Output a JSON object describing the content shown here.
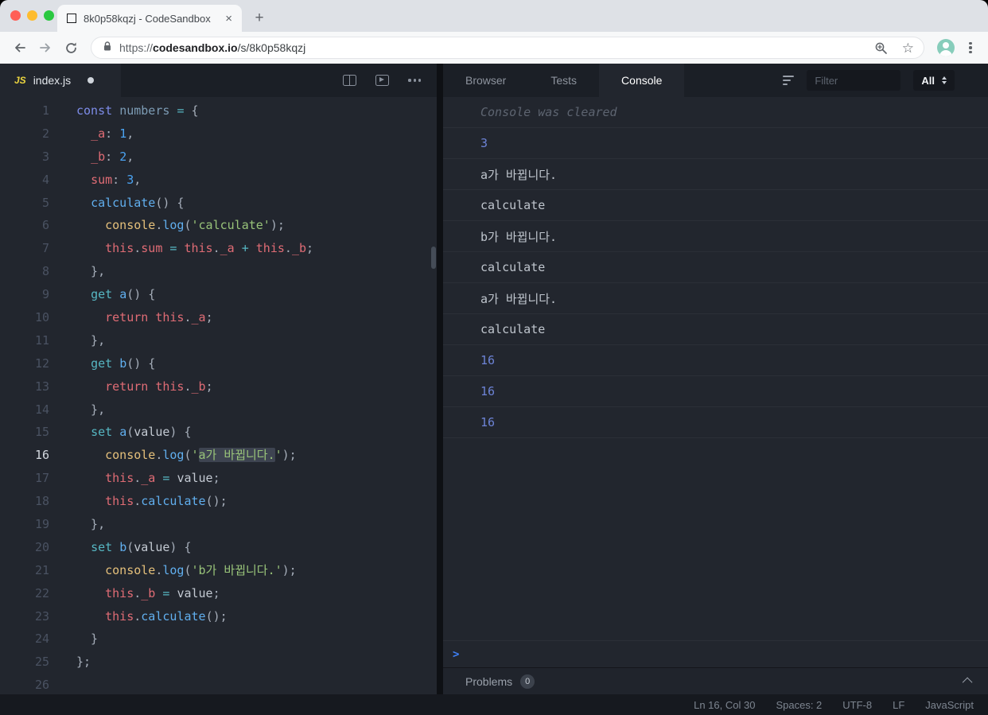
{
  "browser": {
    "tab_title": "8k0p58kqzj - CodeSandbox",
    "close_glyph": "×",
    "new_tab_glyph": "+",
    "star_glyph": "☆",
    "url_scheme": "https://",
    "url_host": "codesandbox.io",
    "url_path": "/s/8k0p58kqzj"
  },
  "editor": {
    "file_tab": {
      "icon_label": "JS",
      "name": "index.js"
    },
    "active_line": 16,
    "code_lines": [
      {
        "n": "1",
        "tk": [
          [
            "kw",
            "const"
          ],
          [
            "def",
            " "
          ],
          [
            "var",
            "numbers"
          ],
          [
            "def",
            " "
          ],
          [
            "op",
            "="
          ],
          [
            "def",
            " {"
          ]
        ]
      },
      {
        "n": "2",
        "tk": [
          [
            "def",
            "  "
          ],
          [
            "prop",
            "_a"
          ],
          [
            "def",
            ": "
          ],
          [
            "num",
            "1"
          ],
          [
            "def",
            ","
          ]
        ]
      },
      {
        "n": "3",
        "tk": [
          [
            "def",
            "  "
          ],
          [
            "prop",
            "_b"
          ],
          [
            "def",
            ": "
          ],
          [
            "num",
            "2"
          ],
          [
            "def",
            ","
          ]
        ]
      },
      {
        "n": "4",
        "tk": [
          [
            "def",
            "  "
          ],
          [
            "prop",
            "sum"
          ],
          [
            "def",
            ": "
          ],
          [
            "num",
            "3"
          ],
          [
            "def",
            ","
          ]
        ]
      },
      {
        "n": "5",
        "tk": [
          [
            "def",
            "  "
          ],
          [
            "fn",
            "calculate"
          ],
          [
            "def",
            "() {"
          ]
        ]
      },
      {
        "n": "6",
        "tk": [
          [
            "def",
            "    "
          ],
          [
            "obj",
            "console"
          ],
          [
            "def",
            "."
          ],
          [
            "fn",
            "log"
          ],
          [
            "def",
            "("
          ],
          [
            "str",
            "'calculate'"
          ],
          [
            "def",
            ");"
          ]
        ]
      },
      {
        "n": "7",
        "tk": [
          [
            "def",
            "    "
          ],
          [
            "this",
            "this"
          ],
          [
            "def",
            "."
          ],
          [
            "prop",
            "sum"
          ],
          [
            "def",
            " "
          ],
          [
            "op",
            "="
          ],
          [
            "def",
            " "
          ],
          [
            "this",
            "this"
          ],
          [
            "def",
            "."
          ],
          [
            "prop",
            "_a"
          ],
          [
            "def",
            " "
          ],
          [
            "op",
            "+"
          ],
          [
            "def",
            " "
          ],
          [
            "this",
            "this"
          ],
          [
            "def",
            "."
          ],
          [
            "prop",
            "_b"
          ],
          [
            "def",
            ";"
          ]
        ]
      },
      {
        "n": "8",
        "tk": [
          [
            "def",
            "  },"
          ]
        ]
      },
      {
        "n": "9",
        "tk": [
          [
            "def",
            "  "
          ],
          [
            "kw2",
            "get"
          ],
          [
            "def",
            " "
          ],
          [
            "fn",
            "a"
          ],
          [
            "def",
            "() {"
          ]
        ]
      },
      {
        "n": "10",
        "tk": [
          [
            "def",
            "    "
          ],
          [
            "ret",
            "return"
          ],
          [
            "def",
            " "
          ],
          [
            "this",
            "this"
          ],
          [
            "def",
            "."
          ],
          [
            "prop",
            "_a"
          ],
          [
            "def",
            ";"
          ]
        ]
      },
      {
        "n": "11",
        "tk": [
          [
            "def",
            "  },"
          ]
        ]
      },
      {
        "n": "12",
        "tk": [
          [
            "def",
            "  "
          ],
          [
            "kw2",
            "get"
          ],
          [
            "def",
            " "
          ],
          [
            "fn",
            "b"
          ],
          [
            "def",
            "() {"
          ]
        ]
      },
      {
        "n": "13",
        "tk": [
          [
            "def",
            "    "
          ],
          [
            "ret",
            "return"
          ],
          [
            "def",
            " "
          ],
          [
            "this",
            "this"
          ],
          [
            "def",
            "."
          ],
          [
            "prop",
            "_b"
          ],
          [
            "def",
            ";"
          ]
        ]
      },
      {
        "n": "14",
        "tk": [
          [
            "def",
            "  },"
          ]
        ]
      },
      {
        "n": "15",
        "tk": [
          [
            "def",
            "  "
          ],
          [
            "kw2",
            "set"
          ],
          [
            "def",
            " "
          ],
          [
            "fn",
            "a"
          ],
          [
            "def",
            "("
          ],
          [
            "param",
            "value"
          ],
          [
            "def",
            ") {"
          ]
        ]
      },
      {
        "n": "16",
        "tk": [
          [
            "def",
            "    "
          ],
          [
            "obj",
            "console"
          ],
          [
            "def",
            "."
          ],
          [
            "fn",
            "log"
          ],
          [
            "def",
            "("
          ],
          [
            "str",
            "'"
          ],
          [
            "str sel",
            "a가 바뀝니다."
          ],
          [
            "str",
            "'"
          ],
          [
            "def",
            ");"
          ]
        ]
      },
      {
        "n": "17",
        "tk": [
          [
            "def",
            "    "
          ],
          [
            "this",
            "this"
          ],
          [
            "def",
            "."
          ],
          [
            "prop",
            "_a"
          ],
          [
            "def",
            " "
          ],
          [
            "op",
            "="
          ],
          [
            "def",
            " "
          ],
          [
            "param",
            "value"
          ],
          [
            "def",
            ";"
          ]
        ]
      },
      {
        "n": "18",
        "tk": [
          [
            "def",
            "    "
          ],
          [
            "this",
            "this"
          ],
          [
            "def",
            "."
          ],
          [
            "fn",
            "calculate"
          ],
          [
            "def",
            "();"
          ]
        ]
      },
      {
        "n": "19",
        "tk": [
          [
            "def",
            "  },"
          ]
        ]
      },
      {
        "n": "20",
        "tk": [
          [
            "def",
            "  "
          ],
          [
            "kw2",
            "set"
          ],
          [
            "def",
            " "
          ],
          [
            "fn",
            "b"
          ],
          [
            "def",
            "("
          ],
          [
            "param",
            "value"
          ],
          [
            "def",
            ") {"
          ]
        ]
      },
      {
        "n": "21",
        "tk": [
          [
            "def",
            "    "
          ],
          [
            "obj",
            "console"
          ],
          [
            "def",
            "."
          ],
          [
            "fn",
            "log"
          ],
          [
            "def",
            "("
          ],
          [
            "str",
            "'b가 바뀝니다.'"
          ],
          [
            "def",
            ");"
          ]
        ]
      },
      {
        "n": "22",
        "tk": [
          [
            "def",
            "    "
          ],
          [
            "this",
            "this"
          ],
          [
            "def",
            "."
          ],
          [
            "prop",
            "_b"
          ],
          [
            "def",
            " "
          ],
          [
            "op",
            "="
          ],
          [
            "def",
            " "
          ],
          [
            "param",
            "value"
          ],
          [
            "def",
            ";"
          ]
        ]
      },
      {
        "n": "23",
        "tk": [
          [
            "def",
            "    "
          ],
          [
            "this",
            "this"
          ],
          [
            "def",
            "."
          ],
          [
            "fn",
            "calculate"
          ],
          [
            "def",
            "();"
          ]
        ]
      },
      {
        "n": "24",
        "tk": [
          [
            "def",
            "  }"
          ]
        ]
      },
      {
        "n": "25",
        "tk": [
          [
            "def",
            "};"
          ]
        ]
      },
      {
        "n": "26",
        "tk": []
      }
    ]
  },
  "console_panel": {
    "tabs": [
      {
        "label": "Browser",
        "active": false
      },
      {
        "label": "Tests",
        "active": false
      },
      {
        "label": "Console",
        "active": true
      }
    ],
    "filter_placeholder": "Filter",
    "level_selected": "All",
    "prompt": ">",
    "rows": [
      {
        "type": "info",
        "text": "Console was cleared"
      },
      {
        "type": "value",
        "text": "3"
      },
      {
        "type": "log",
        "text": "a가 바뀝니다."
      },
      {
        "type": "log",
        "text": "calculate"
      },
      {
        "type": "log",
        "text": "b가 바뀝니다."
      },
      {
        "type": "log",
        "text": "calculate"
      },
      {
        "type": "log",
        "text": "a가 바뀝니다."
      },
      {
        "type": "log",
        "text": "calculate"
      },
      {
        "type": "value",
        "text": "16"
      },
      {
        "type": "value",
        "text": "16"
      },
      {
        "type": "value",
        "text": "16"
      }
    ]
  },
  "problems": {
    "label": "Problems",
    "count": "0"
  },
  "status_bar": {
    "items": [
      "Ln 16, Col 30",
      "Spaces: 2",
      "UTF-8",
      "LF",
      "JavaScript"
    ]
  },
  "colors": {
    "accent_blue": "#3f80f6",
    "console_value": "#6d83d6",
    "string_green": "#98c379",
    "property_red": "#e06c75",
    "keyword_blue": "#7d8ce8",
    "editor_bg": "#22262e"
  }
}
